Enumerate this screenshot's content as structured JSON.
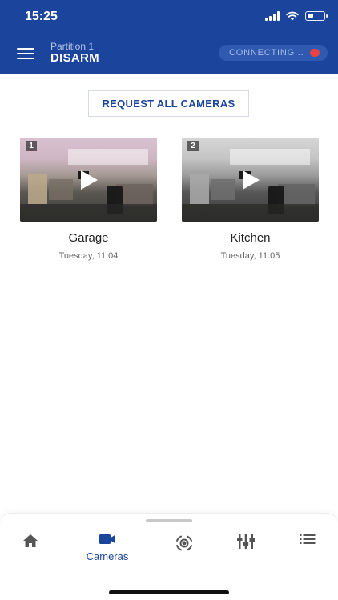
{
  "status_bar": {
    "time": "15:25"
  },
  "header": {
    "partition_label": "Partition 1",
    "partition_state": "DISARM",
    "connection_status": "CONNECTING..."
  },
  "request_button_label": "REQUEST ALL CAMERAS",
  "cameras": [
    {
      "number": "1",
      "name": "Garage",
      "time": "Tuesday, 11:04"
    },
    {
      "number": "2",
      "name": "Kitchen",
      "time": "Tuesday, 11:05"
    }
  ],
  "bottom_nav": {
    "items": [
      {
        "icon": "home-icon",
        "label": ""
      },
      {
        "icon": "video-camera-icon",
        "label": "Cameras",
        "active": true
      },
      {
        "icon": "motion-sensor-icon",
        "label": ""
      },
      {
        "icon": "sliders-icon",
        "label": ""
      },
      {
        "icon": "list-icon",
        "label": ""
      }
    ]
  },
  "colors": {
    "header_bg": "#1b449c",
    "accent": "#1b449c",
    "conn_dot": "#e74343"
  }
}
